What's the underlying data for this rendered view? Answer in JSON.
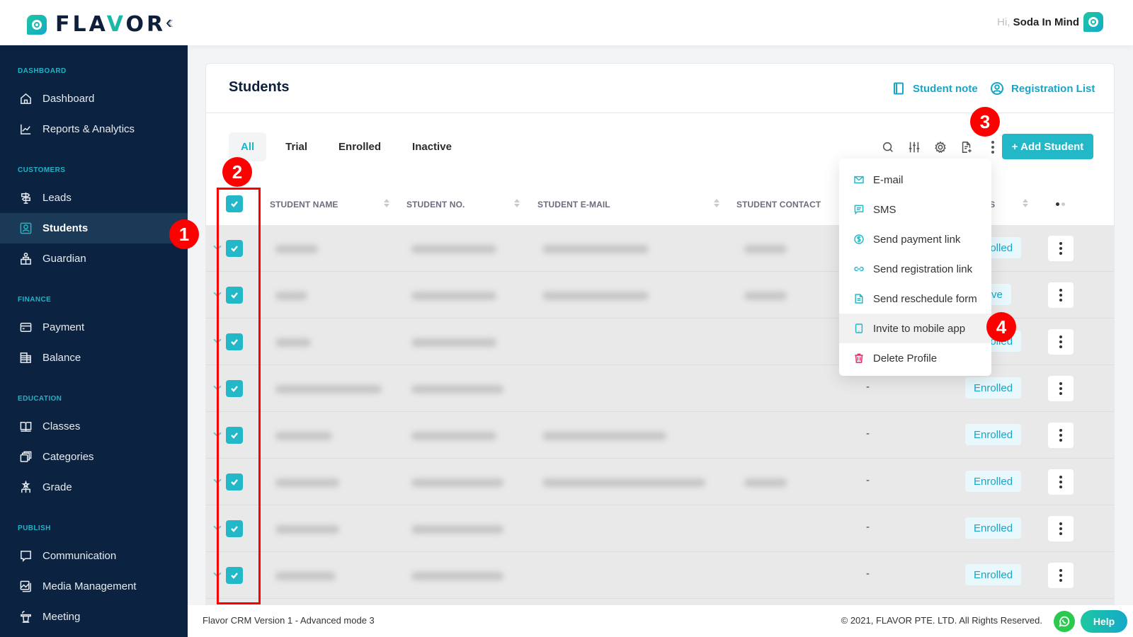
{
  "app": {
    "brand": "FLAVOR",
    "greeting_prefix": "Hi,",
    "user_name": "Soda In Mind"
  },
  "sidebar": {
    "sections": [
      {
        "label": "DASHBOARD",
        "items": [
          {
            "label": "Dashboard",
            "icon": "home-icon"
          },
          {
            "label": "Reports & Analytics",
            "icon": "chart-line-icon"
          }
        ]
      },
      {
        "label": "CUSTOMERS",
        "items": [
          {
            "label": "Leads",
            "icon": "signpost-icon"
          },
          {
            "label": "Students",
            "icon": "user-square-icon",
            "active": true
          },
          {
            "label": "Guardian",
            "icon": "guardian-icon"
          }
        ]
      },
      {
        "label": "FINANCE",
        "items": [
          {
            "label": "Payment",
            "icon": "credit-card-icon"
          },
          {
            "label": "Balance",
            "icon": "balance-icon"
          }
        ]
      },
      {
        "label": "EDUCATION",
        "items": [
          {
            "label": "Classes",
            "icon": "book-open-icon"
          },
          {
            "label": "Categories",
            "icon": "stack-icon"
          },
          {
            "label": "Grade",
            "icon": "grade-icon"
          }
        ]
      },
      {
        "label": "PUBLISH",
        "items": [
          {
            "label": "Communication",
            "icon": "message-square-icon"
          },
          {
            "label": "Media Management",
            "icon": "image-stack-icon"
          },
          {
            "label": "Meeting",
            "icon": "podium-icon"
          }
        ]
      }
    ]
  },
  "page": {
    "title": "Students",
    "links": {
      "student_note": "Student note",
      "registration_list": "Registration List"
    },
    "tabs": [
      {
        "label": "All",
        "active": true
      },
      {
        "label": "Trial"
      },
      {
        "label": "Enrolled"
      },
      {
        "label": "Inactive"
      }
    ],
    "toolbar": {
      "icons": [
        "search-icon",
        "filter-sliders-icon",
        "gear-icon",
        "file-add-icon",
        "more-vertical-icon"
      ],
      "add_label": "+ Add Student"
    },
    "table": {
      "columns": [
        "STUDENT NAME",
        "STUDENT NO.",
        "STUDENT E-MAIL",
        "STUDENT CONTACT",
        "ATUS"
      ],
      "rows": [
        {
          "checked": true,
          "name": "[blurred]",
          "student_no": "[blurred]",
          "email": "[blurred]",
          "contact": "[blurred]",
          "guardian": "",
          "status": "Enrolled"
        },
        {
          "checked": true,
          "name": "[blurred]",
          "student_no": "[blurred]",
          "email": "[blurred]",
          "contact": "[blurred]",
          "guardian": "",
          "status": "Active"
        },
        {
          "checked": true,
          "name": "[blurred]",
          "student_no": "[blurred]",
          "email": "-",
          "contact": "-",
          "guardian": "",
          "status": "Enrolled"
        },
        {
          "checked": true,
          "name": "[blurred]",
          "student_no": "[blurred]",
          "email": "-",
          "contact": "-",
          "guardian": "-",
          "status": "Enrolled"
        },
        {
          "checked": true,
          "name": "[blurred]",
          "student_no": "[blurred]",
          "email": "[blurred]",
          "contact": "-",
          "guardian": "-",
          "status": "Enrolled"
        },
        {
          "checked": true,
          "name": "[blurred]",
          "student_no": "[blurred]",
          "email": "[blurred]",
          "contact": "[blurred]",
          "guardian": "-",
          "status": "Enrolled"
        },
        {
          "checked": true,
          "name": "[blurred]",
          "student_no": "[blurred]",
          "email": "-",
          "contact": "-",
          "guardian": "-",
          "status": "Enrolled"
        },
        {
          "checked": true,
          "name": "[blurred]",
          "student_no": "[blurred]",
          "email": "-",
          "contact": "-",
          "guardian": "-",
          "status": "Enrolled"
        }
      ]
    },
    "dropdown": {
      "items": [
        {
          "label": "E-mail",
          "icon": "mail-icon"
        },
        {
          "label": "SMS",
          "icon": "sms-icon"
        },
        {
          "label": "Send payment link",
          "icon": "dollar-circle-icon"
        },
        {
          "label": "Send registration link",
          "icon": "link-icon"
        },
        {
          "label": "Send reschedule form",
          "icon": "document-icon"
        },
        {
          "label": "Invite to mobile app",
          "icon": "mobile-icon",
          "hover": true
        },
        {
          "label": "Delete Profile",
          "icon": "trash-icon",
          "danger": true
        }
      ]
    }
  },
  "annotations": [
    "1",
    "2",
    "3",
    "4"
  ],
  "footer": {
    "version": "Flavor CRM Version 1 - Advanced mode 3",
    "copyright": "© 2021, FLAVOR PTE. LTD. All Rights Reserved.",
    "help_label": "Help"
  },
  "colors": {
    "accent": "#22b8c8",
    "sidebar_bg": "#0b2340",
    "danger": "#e0245e",
    "annotation": "#ff0000"
  }
}
